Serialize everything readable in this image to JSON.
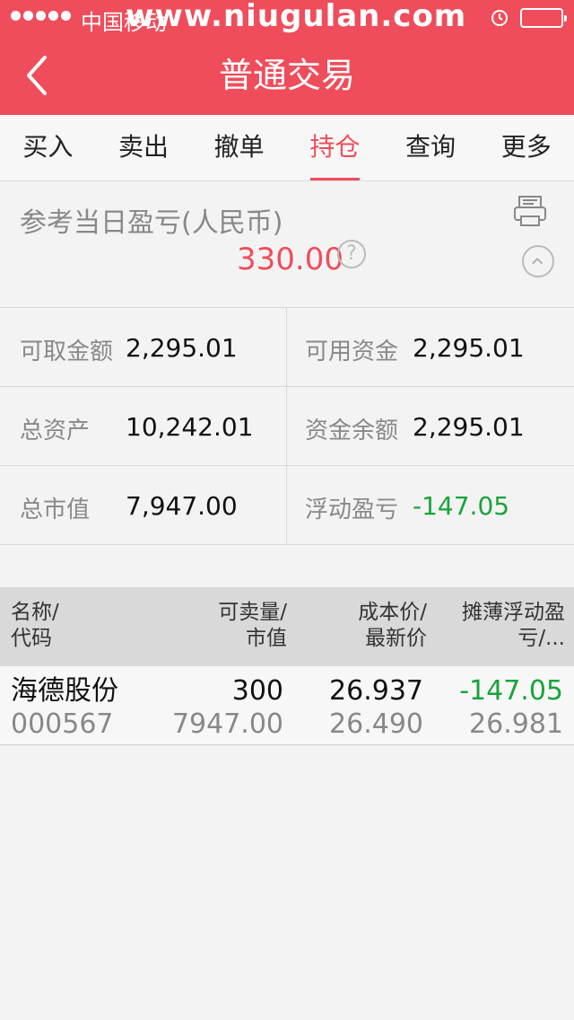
{
  "status_bar": {
    "carrier": "中国移动",
    "watermark": "www.niugulan.com"
  },
  "header": {
    "title": "普通交易"
  },
  "tabs": [
    {
      "label": "买入"
    },
    {
      "label": "卖出"
    },
    {
      "label": "撤单"
    },
    {
      "label": "持仓",
      "active": true
    },
    {
      "label": "查询"
    },
    {
      "label": "更多"
    }
  ],
  "summary": {
    "label": "参考当日盈亏(人民币)",
    "value": "330.00",
    "help": "?"
  },
  "balances": [
    {
      "left": {
        "label": "可取金额",
        "value": "2,295.01"
      },
      "right": {
        "label": "可用资金",
        "value": "2,295.01"
      }
    },
    {
      "left": {
        "label": "总资产",
        "value": "10,242.01"
      },
      "right": {
        "label": "资金余额",
        "value": "2,295.01"
      }
    },
    {
      "left": {
        "label": "总市值",
        "value": "7,947.00"
      },
      "right": {
        "label": "浮动盈亏",
        "value": "-147.05"
      }
    }
  ],
  "holdings": {
    "headers": [
      {
        "line1": "名称/",
        "line2": "代码"
      },
      {
        "line1": "可卖量/",
        "line2": "市值"
      },
      {
        "line1": "成本价/",
        "line2": "最新价"
      },
      {
        "line1": "摊薄浮动盈",
        "line2": "亏/..."
      }
    ],
    "rows": [
      {
        "name": "海德股份",
        "code": "000567",
        "sellable": "300",
        "market_value": "7947.00",
        "cost": "26.937",
        "latest": "26.490",
        "pnl": "-147.05",
        "diluted": "26.981"
      }
    ]
  },
  "colors": {
    "accent": "#ef4d5b",
    "loss": "#17a43a"
  }
}
